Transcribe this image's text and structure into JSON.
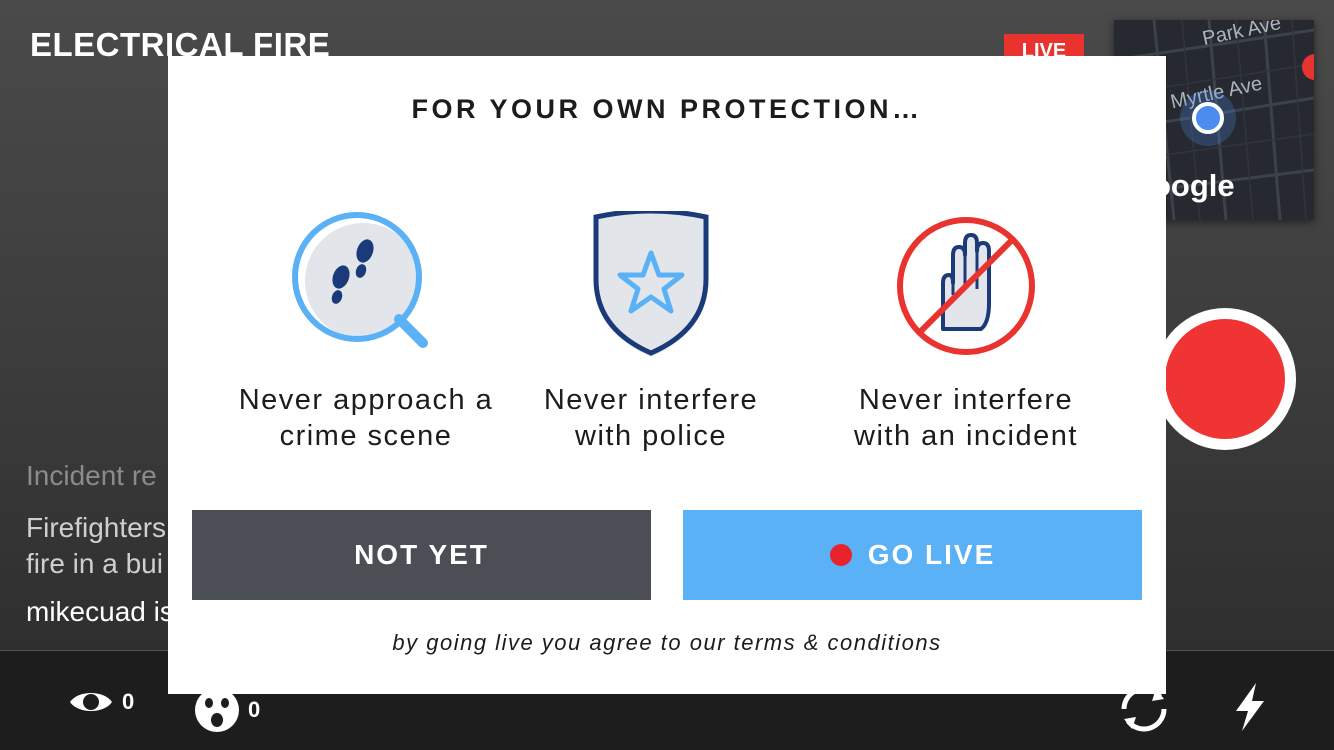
{
  "background": {
    "title": "ELECTRICAL FIRE",
    "live_badge": "LIVE",
    "map": {
      "street_1": "Park Ave",
      "street_2": "Myrtle Ave",
      "brand": "oogle"
    },
    "lines": {
      "incident_prefix": "Incident re",
      "description_line_1": "Firefighters",
      "description_line_2": "fire in a bui",
      "user_line": "mikecuad is"
    },
    "bottom_bar": {
      "views_count": "0",
      "scared_count": "0"
    }
  },
  "modal": {
    "title": "FOR YOUR OWN PROTECTION…",
    "rules": [
      {
        "line1": "Never approach a",
        "line2": "crime scene",
        "icon": "footprints-magnifier-icon"
      },
      {
        "line1": "Never interfere",
        "line2": "with police",
        "icon": "police-shield-icon"
      },
      {
        "line1": "Never interfere",
        "line2": "with an incident",
        "icon": "no-hand-icon"
      }
    ],
    "not_yet_label": "NOT YET",
    "go_live_label": "GO LIVE",
    "terms": "by going live you agree to our terms & conditions"
  },
  "colors": {
    "accent_blue": "#5ab1f5",
    "dark_button": "#4b4e55",
    "live_red": "#e8332e",
    "shield_navy": "#1a3a7a"
  }
}
